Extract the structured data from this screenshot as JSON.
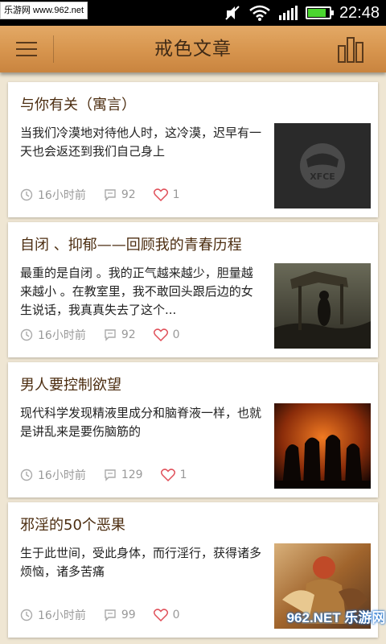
{
  "statusbar": {
    "watermark": "乐游网 www.962.net",
    "time": "22:48",
    "battery_level": 0.85,
    "icons": [
      "mute-icon",
      "wifi-icon",
      "signal-icon",
      "battery-icon"
    ]
  },
  "actionbar": {
    "title": "戒色文章",
    "menu_icon": "hamburger-icon",
    "right_icon": "bar-chart-icon"
  },
  "articles": [
    {
      "title": "与你有关（寓言）",
      "desc": "当我们冷漠地对待他人时，这冷漠，迟早有一天也会返还到我们自己身上",
      "time": "16小时前",
      "comments": "92",
      "likes": "1",
      "thumb_caption": "XFCE"
    },
    {
      "title": "自闭 、抑郁——回顾我的青春历程",
      "desc": "最重的是自闭 。我的正气越来越少，胆量越来越小 。在教室里，我不敢回头跟后边的女生说话，我真真失去了这个...",
      "time": "16小时前",
      "comments": "92",
      "likes": "0"
    },
    {
      "title": "男人要控制欲望",
      "desc": "现代科学发现精液里成分和脑脊液一样，也就是讲乱来是要伤脑筋的",
      "time": "16小时前",
      "comments": "129",
      "likes": "1"
    },
    {
      "title": "邪淫的50个恶果",
      "desc": "生于此世间，受此身体，而行淫行，获得诸多烦恼，诸多苦痛",
      "time": "16小时前",
      "comments": "99",
      "likes": "0"
    }
  ],
  "footer_watermark": "962.NET 乐游网",
  "colors": {
    "actionbar": "#d8964f",
    "title_text": "#4c2d10",
    "meta_text": "#999999",
    "heart": "#e0505a",
    "background": "#efe6d3"
  }
}
